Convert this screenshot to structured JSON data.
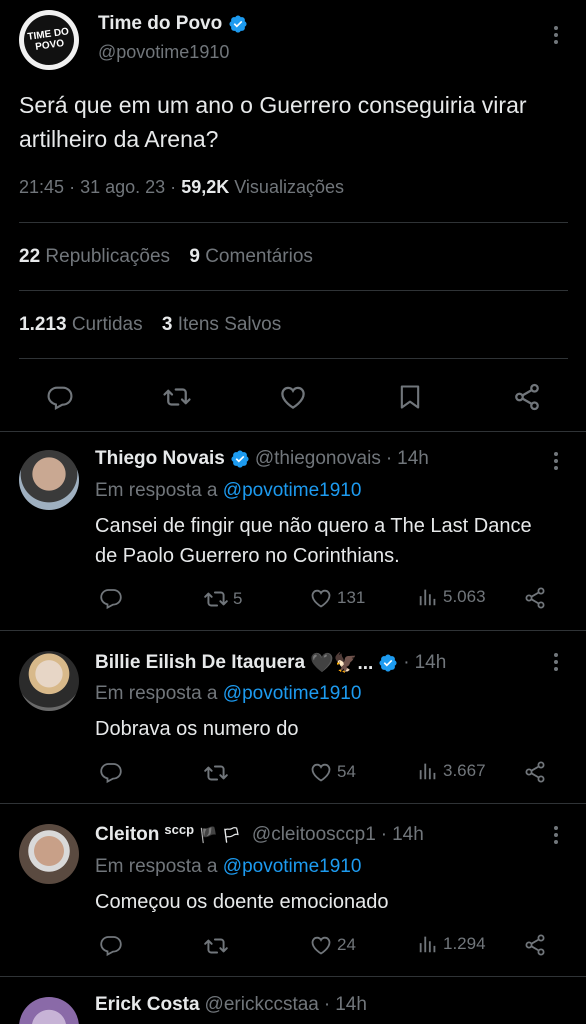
{
  "main_tweet": {
    "logo_text_line1": "TIME DO",
    "logo_text_line2": "POVO",
    "name": "Time do Povo",
    "handle": "@povotime1910",
    "text": "Será que em um ano o Guerrero conseguiria virar artilheiro da Arena?",
    "time": "21:45",
    "date": "31 ago. 23",
    "views_count": "59,2K",
    "views_label": "Visualizações",
    "reposts_count": "22",
    "reposts_label": "Republicações",
    "comments_count": "9",
    "comments_label": "Comentários",
    "likes_count": "1.213",
    "likes_label": "Curtidas",
    "saved_count": "3",
    "saved_label": "Itens Salvos"
  },
  "replies": [
    {
      "name": "Thiego Novais",
      "handle": "@thiegonovais",
      "time": "14h",
      "reply_prefix": "Em resposta a",
      "reply_to": "@povotime1910",
      "text": "Cansei de fingir que não quero a The Last Dance de Paolo Guerrero no Corinthians.",
      "retweets": "5",
      "likes": "131",
      "views": "5.063"
    },
    {
      "name": "Billie Eilish De Itaquera",
      "name_emoji": "🖤🦅...",
      "handle": "",
      "time": "14h",
      "reply_prefix": "Em resposta a",
      "reply_to": "@povotime1910",
      "text": "Dobrava os numero do",
      "retweets": "",
      "likes": "54",
      "views": "3.667"
    },
    {
      "name": "Cleiton",
      "name_suffix": "sccp",
      "name_emoji": "🏴 🏳",
      "handle": "@cleitoosccp1",
      "time": "14h",
      "reply_prefix": "Em resposta a",
      "reply_to": "@povotime1910",
      "text": "Começou os doente emocionado",
      "retweets": "",
      "likes": "24",
      "views": "1.294"
    },
    {
      "name": "Erick Costa",
      "handle": "@erickccstaa",
      "time": "14h"
    }
  ],
  "separator": "·",
  "colors": {
    "background": "#000000",
    "text": "#e7e9ea",
    "muted": "#71767b",
    "link": "#1d9bf0",
    "divider": "#2f3336",
    "verified": "#1d9bf0"
  }
}
